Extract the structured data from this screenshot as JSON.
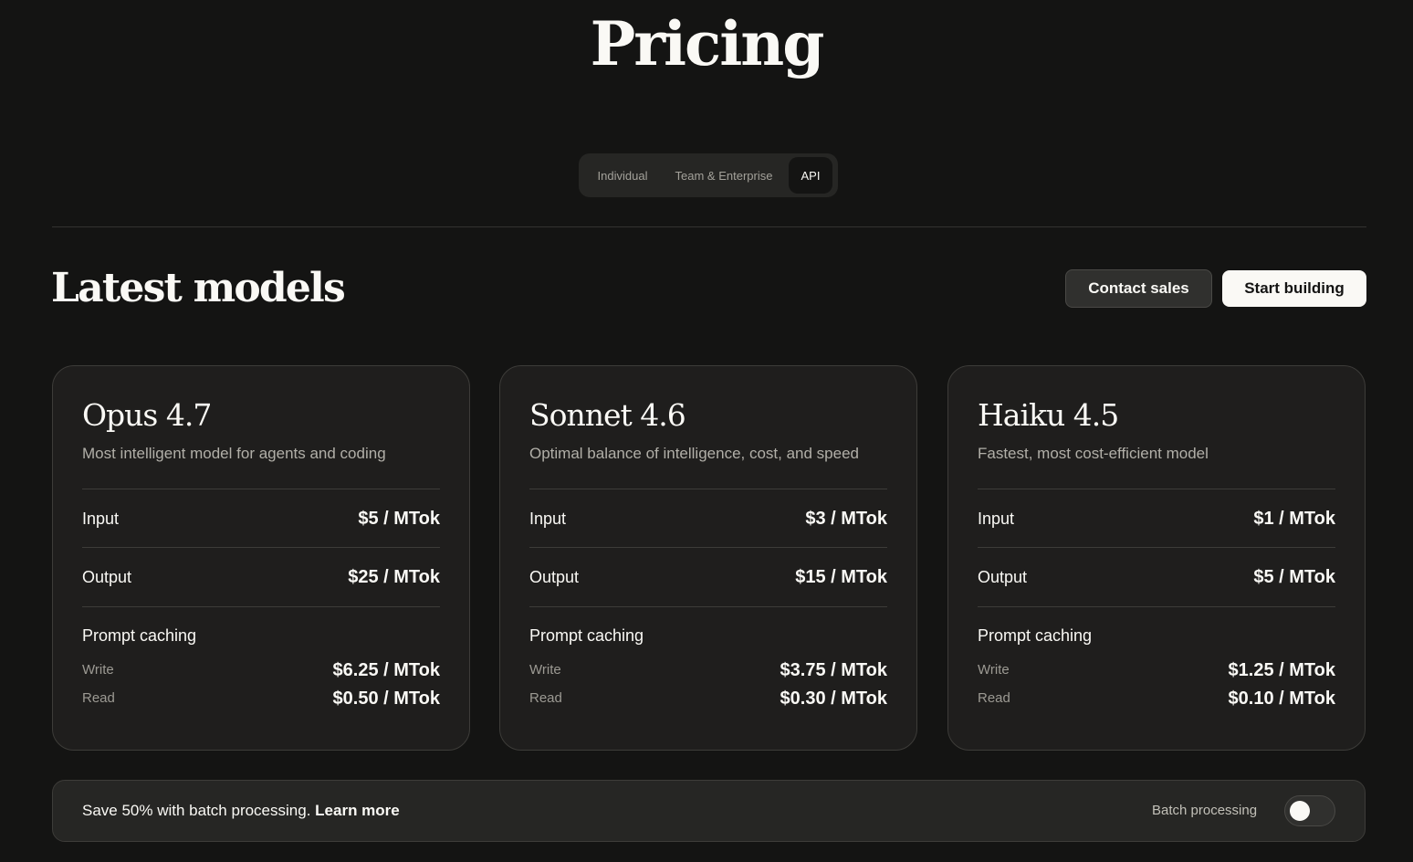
{
  "page": {
    "title": "Pricing"
  },
  "tabs": [
    {
      "label": "Individual",
      "active": false
    },
    {
      "label": "Team & Enterprise",
      "active": false
    },
    {
      "label": "API",
      "active": true
    }
  ],
  "section": {
    "title": "Latest models",
    "contact_label": "Contact sales",
    "start_label": "Start building"
  },
  "models": [
    {
      "name": "Opus 4.7",
      "description": "Most intelligent model for agents and coding",
      "input_label": "Input",
      "input_price": "$5 / MTok",
      "output_label": "Output",
      "output_price": "$25 / MTok",
      "caching_label": "Prompt caching",
      "write_label": "Write",
      "write_price": "$6.25 / MTok",
      "read_label": "Read",
      "read_price": "$0.50 / MTok"
    },
    {
      "name": "Sonnet 4.6",
      "description": "Optimal balance of intelligence, cost, and speed",
      "input_label": "Input",
      "input_price": "$3 / MTok",
      "output_label": "Output",
      "output_price": "$15 / MTok",
      "caching_label": "Prompt caching",
      "write_label": "Write",
      "write_price": "$3.75 / MTok",
      "read_label": "Read",
      "read_price": "$0.30 / MTok"
    },
    {
      "name": "Haiku 4.5",
      "description": "Fastest, most cost-efficient model",
      "input_label": "Input",
      "input_price": "$1 / MTok",
      "output_label": "Output",
      "output_price": "$5 / MTok",
      "caching_label": "Prompt caching",
      "write_label": "Write",
      "write_price": "$1.25 / MTok",
      "read_label": "Read",
      "read_price": "$0.10 / MTok"
    }
  ],
  "batch": {
    "text": "Save 50% with batch processing.",
    "link": "Learn more",
    "toggle_label": "Batch processing",
    "toggle_on": false
  },
  "colors": {
    "background": "#141413",
    "card": "#1f1e1d",
    "text": "#faf9f5",
    "muted": "#b1afa8"
  }
}
